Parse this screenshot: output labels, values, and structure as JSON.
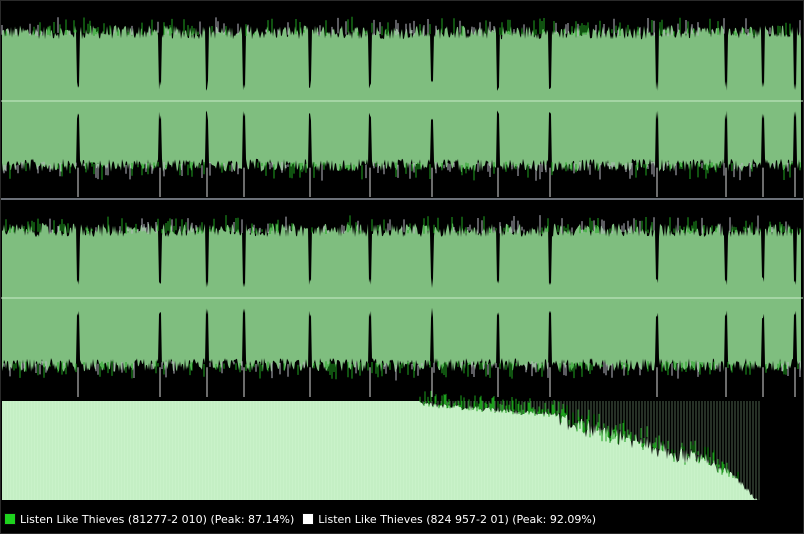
{
  "colors": {
    "background": "#000000",
    "wave_fill": "#7fbe7f",
    "wave_spike_green": "#1fa51f",
    "wave_spike_grey": "#b8b8c2",
    "center_line": "#c8ecc8",
    "separator": "#6b7078",
    "spectrum_fill": "#c9f2c9",
    "spectrum_spike": "#1da01d",
    "legend_text": "#ffffff"
  },
  "legend": {
    "items": [
      {
        "label": "Listen Like Thieves (81277-2 010) (Peak: 87.14%)",
        "color": "#1ed21e"
      },
      {
        "label": "Listen Like Thieves (824 957-2 01) (Peak: 92.09%)",
        "color": "#ffffff"
      }
    ]
  },
  "tracks": {
    "segment_boundaries": [
      78,
      160,
      207,
      244,
      310,
      370,
      432,
      498,
      550,
      657,
      726,
      763,
      795
    ]
  }
}
